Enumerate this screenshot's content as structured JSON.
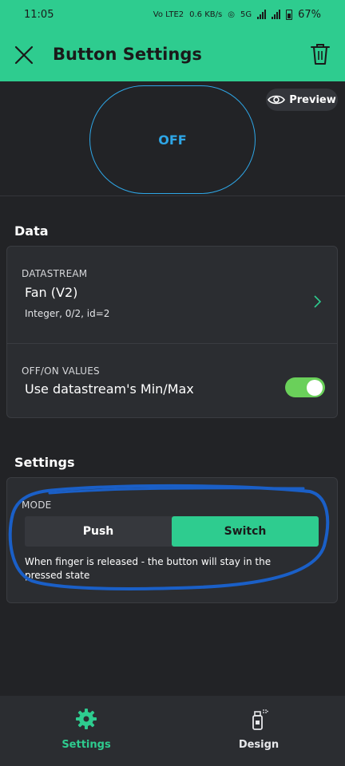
{
  "status_bar": {
    "time": "11:05",
    "net_type": "Vo LTE2",
    "speed": "0.6 KB/s",
    "network": "5G",
    "battery": "67%"
  },
  "header": {
    "title": "Button Settings",
    "close_icon": "close-icon",
    "delete_icon": "trash-icon"
  },
  "preview": {
    "widget_label": "OFF",
    "preview_label": "Preview",
    "preview_icon": "eye-icon"
  },
  "data_section": {
    "title": "Data",
    "datastream": {
      "label": "DATASTREAM",
      "value": "Fan (V2)",
      "details": "Integer, 0/2, id=2"
    },
    "off_on_values": {
      "label": "OFF/ON VALUES",
      "value": "Use datastream's Min/Max",
      "enabled": true
    }
  },
  "settings_section": {
    "title": "Settings",
    "mode": {
      "label": "MODE",
      "options": [
        "Push",
        "Switch"
      ],
      "selected": "Switch",
      "description": "When finger is released - the button will stay in the pressed state"
    }
  },
  "bottom_nav": {
    "items": [
      {
        "label": "Settings",
        "icon": "gear-icon",
        "active": true
      },
      {
        "label": "Design",
        "icon": "spray-can-icon",
        "active": false
      }
    ]
  },
  "colors": {
    "accent": "#2ecc8f",
    "background": "#222326",
    "card": "#2b2d31",
    "widget_outline": "#2ea6e6",
    "toggle_on": "#6ad05a",
    "annotation": "#1a5fc7"
  }
}
